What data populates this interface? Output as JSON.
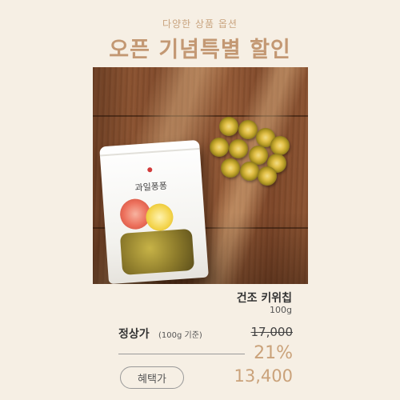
{
  "header": {
    "subtitle": "다양한 상품 옵션",
    "title": "오픈 기념특별 할인"
  },
  "product": {
    "package_label": "과일퐁퐁",
    "name": "건조 키위칩",
    "weight": "100g"
  },
  "pricing": {
    "regular_label": "정상가",
    "regular_basis": "(100g 기준)",
    "regular_price": "17,000",
    "discount_rate": "21%",
    "benefit_label": "혜택가",
    "sale_price": "13,400"
  },
  "colors": {
    "background": "#f6efe4",
    "accent": "#caa27a",
    "title": "#c39873"
  }
}
